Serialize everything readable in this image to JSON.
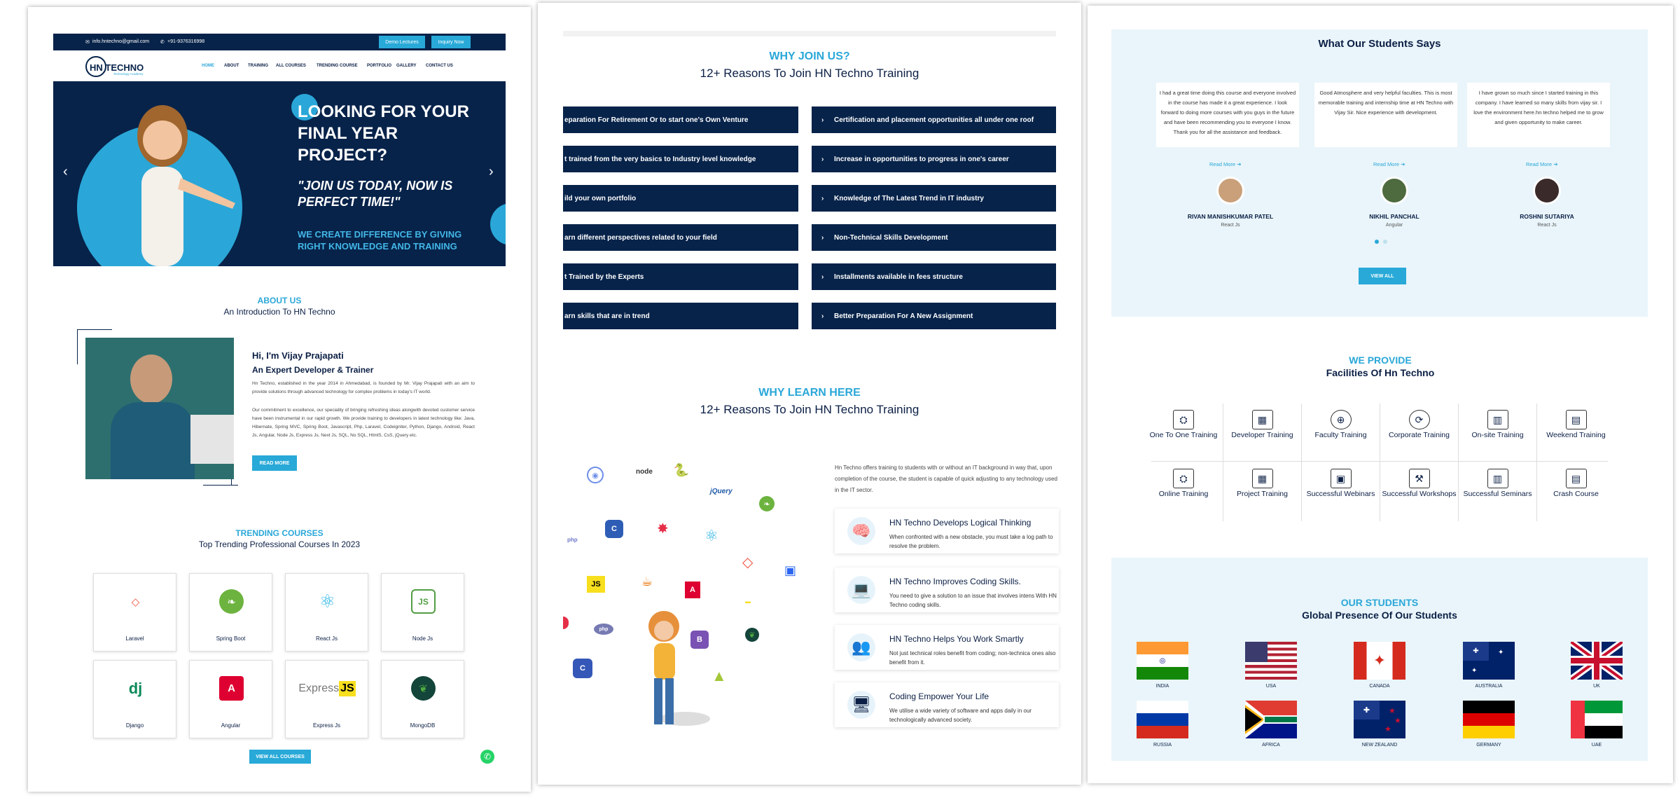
{
  "panel1": {
    "topbar": {
      "email": "info.hntechno@gmail.com",
      "phone": "+91-9376316998",
      "demo": "Demo Lectures",
      "inquiry": "Inquiry Now"
    },
    "logo": {
      "text": "HN TECHNO",
      "tagline": "Technology Academy"
    },
    "nav": [
      "HOME",
      "ABOUT",
      "TRAINING",
      "ALL COURSES",
      "TRENDING COURSE",
      "PORTFOLIO",
      "GALLERY",
      "CONTACT US"
    ],
    "hero": {
      "headline": "LOOKING FOR YOUR FINAL YEAR PROJECT?",
      "quote": "\"JOIN US TODAY, NOW IS PERFECT TIME!\"",
      "sub": "WE CREATE DIFFERENCE BY GIVING RIGHT KNOWLEDGE AND TRAINING"
    },
    "about": {
      "kicker": "ABOUT US",
      "title": "An Introduction To HN Techno",
      "name": "Hi, I'm Vijay Prajapati",
      "role": "An Expert Developer & Trainer",
      "p1": "Hn Techno, established in the year 2014 in Ahmedabad, is founded by Mr. Vijay Prajapati with an aim to provide solutions through advanced technology for complex problems in today's IT world.",
      "p2": "Our commitment to excellence, our speciality of bringing refreshing ideas alongwith devoted customer service have been instrumental in our rapid growth. We provide training to developers in latest technology like: Java, Hibernate, Spring MVC, Spring Boot, Javascript, Php, Laravel, Codeigniter, Python, Django, Android, React Js, Angular, Node Js, Express Js, Next Js, SQL, No SQL, HtmlS, CsS, jQuery etc.",
      "btn": "READ MORE"
    },
    "trending": {
      "kicker": "TRENDING COURSES",
      "title": "Top Trending Professional Courses In 2023",
      "courses": [
        "Laravel",
        "Spring Boot",
        "React Js",
        "Node Js",
        "Django",
        "Angular",
        "Express Js",
        "MongoDB"
      ],
      "btn": "VIEW ALL COURSES"
    }
  },
  "panel2": {
    "why": {
      "kicker": "WHY JOIN US?",
      "title": "12+ Reasons To Join HN Techno Training",
      "left": [
        "eparation For Retirement Or to start one's Own Venture",
        "t trained from the very basics to Industry level knowledge",
        "ild your own portfolio",
        "arn different perspectives related to your field",
        "t Trained by the Experts",
        "arn skills that are in trend"
      ],
      "right": [
        "Certification and placement opportunities all under one roof",
        "Increase in opportunities to progress in one's career",
        "Knowledge of The Latest Trend in IT industry",
        "Non-Technical Skills Development",
        "Installments available in fees structure",
        "Better Preparation For A New Assignment"
      ]
    },
    "learn": {
      "kicker": "WHY LEARN HERE",
      "title": "12+ Reasons To Join HN Techno Training",
      "intro": "Hn Techno offers training to students with or without an IT background in way that, upon completion of the course, the student is capable of quick adjusting to any technology used in the IT sector.",
      "items": [
        {
          "title": "HN Techno Develops Logical Thinking",
          "desc": "When confronted with a new obstacle, you must take a log path to resolve the problem."
        },
        {
          "title": "HN Techno Improves Coding Skills.",
          "desc": "You need to give a solution to an issue that involves intens With HN Techno coding skills."
        },
        {
          "title": "HN Techno Helps You Work Smartly",
          "desc": "Not just technical roles benefit from coding; non-technica ones also benefit from it."
        },
        {
          "title": "Coding Empower Your Life",
          "desc": "We utilise a wide variety of software and apps daily in our technologically advanced society."
        }
      ]
    }
  },
  "panel3": {
    "testimonials": {
      "title": "What Our Students Says",
      "items": [
        {
          "text": "I had a great time doing this course and everyone involved in the course has made it a great experience. I look forward to doing more courses with you guys in the future and have been recommending you to everyone I know. Thank you for all the assistance and feedback.",
          "name": "RIVAN MANISHKUMAR PATEL",
          "course": "React Js"
        },
        {
          "text": "Good Atmosphere and very helpful faculties. This is most memorable training and internship time at HN Techno with Vijay Sir. Nice experience with development.",
          "name": "NIKHIL PANCHAL",
          "course": "Angular"
        },
        {
          "text": "I have grown so much since I started training in this company. I have learned so many skills from vijay sir. I love the environment here.hn techno helped me to grow and given opportunity to make career.",
          "name": "ROSHNI SUTARIYA",
          "course": "React Js"
        }
      ],
      "read": "Read More",
      "btn": "VIEW ALL"
    },
    "facilities": {
      "kicker": "WE PROVIDE",
      "title": "Facilities Of Hn Techno",
      "items": [
        "One To One Training",
        "Developer Training",
        "Faculty Training",
        "Corporate Training",
        "On-site Training",
        "Weekend Training",
        "Online Training",
        "Project Training",
        "Successful Webinars",
        "Successful Workshops",
        "Successful Seminars",
        "Crash Course"
      ]
    },
    "students": {
      "kicker": "OUR STUDENTS",
      "title": "Global Presence Of Our Students",
      "countries": [
        "INDIA",
        "USA",
        "CANADA",
        "AUSTRALIA",
        "UK",
        "RUSSIA",
        "AFRICA",
        "NEW ZEALAND",
        "GERMANY",
        "UAE"
      ]
    }
  }
}
